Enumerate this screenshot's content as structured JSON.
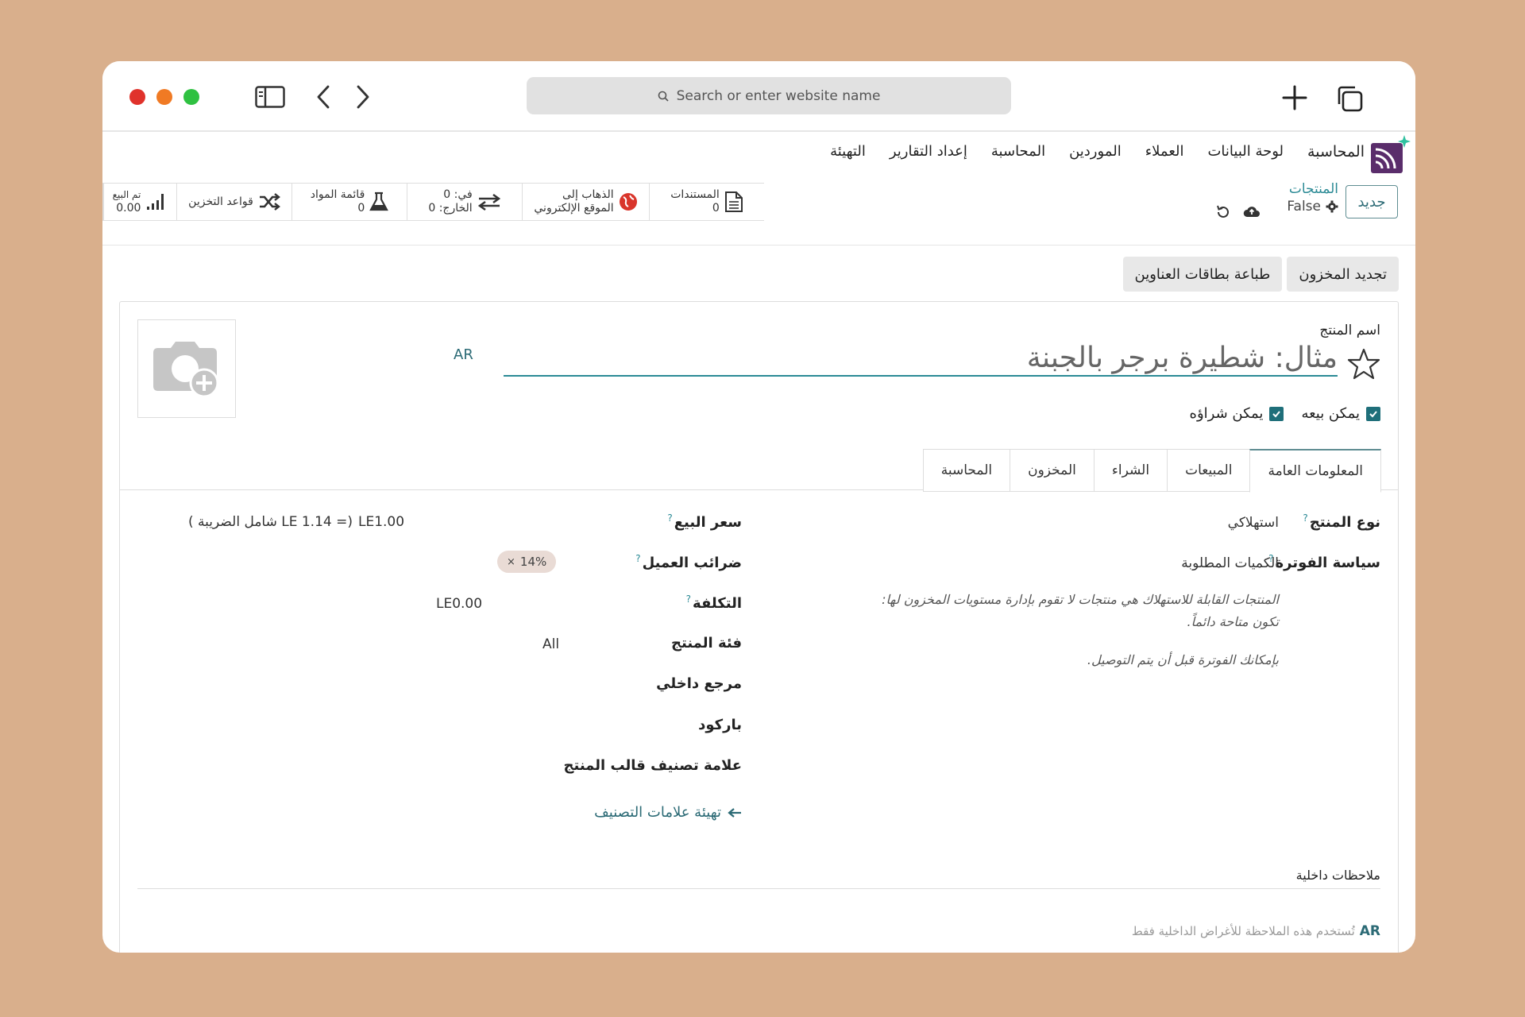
{
  "browser": {
    "address_placeholder": "Search or enter website name",
    "dot_colors": [
      "#e0322b",
      "#f07a24",
      "#2fc141"
    ]
  },
  "nav": {
    "items": [
      "المحاسبة",
      "لوحة البيانات",
      "العملاء",
      "الموردين",
      "المحاسبة",
      "إعداد التقارير",
      "التهيئة"
    ]
  },
  "control": {
    "new_label": "جديد",
    "breadcrumb": "المنتجات",
    "record_name": "False"
  },
  "smart_buttons": {
    "documents": {
      "label": "المستندات",
      "count": "0"
    },
    "website": {
      "line1": "الذهاب إلى",
      "line2": "الموقع الإلكتروني"
    },
    "moves": {
      "in": "في: 0",
      "out": "الخارج: 0"
    },
    "bom": {
      "label": "قائمة المواد",
      "count": "0"
    },
    "routes": {
      "label": "قواعد التخزين"
    },
    "sold": {
      "label": "تم البيع",
      "value": "0.00"
    }
  },
  "actions": {
    "update_qty": "تجديد المخزون",
    "print_labels": "طباعة بطاقات العناوين"
  },
  "product": {
    "name_label": "اسم المنتج",
    "name_placeholder": "مثال: شطيرة برجر بالجبنة",
    "lang": "AR",
    "can_be_sold": "يمكن بيعه",
    "can_be_purchased": "يمكن شراؤه"
  },
  "tabs": [
    "المعلومات العامة",
    "المبيعات",
    "الشراء",
    "المخزون",
    "المحاسبة"
  ],
  "general": {
    "type_label": "نوع المنتج",
    "type_value": "استهلاكي",
    "invoice_label": "سياسة الفوترة",
    "invoice_value": "الكميات المطلوبة",
    "help1_line1": "المنتجات القابلة للاستهلاك هي منتجات لا تقوم بإدارة مستويات المخزون لها:",
    "help1_line2": "تكون متاحة دائماً.",
    "help2": "بإمكانك الفوترة قبل أن يتم التوصيل.",
    "price_label": "سعر البيع",
    "price_value": "LE1.00",
    "price_tax": "(= LE 1.14 شامل الضريبة )",
    "tax_label": "ضرائب العميل",
    "tax_value": "14%",
    "cost_label": "التكلفة",
    "cost_value": "LE0.00",
    "category_label": "فئة المنتج",
    "category_value": "All",
    "ref_label": "مرجع داخلي",
    "barcode_label": "باركود",
    "tags_label": "علامة تصنيف قالب المنتج",
    "tags_link": "تهيئة علامات التصنيف"
  },
  "notes": {
    "label": "ملاحظات داخلية",
    "lang": "AR",
    "placeholder": "تُستخدم هذه الملاحظة للأغراض الداخلية فقط"
  },
  "colors": {
    "accent": "#2b8a95",
    "checkbox": "#1f6f7a",
    "logo": "#5a2d6b"
  }
}
